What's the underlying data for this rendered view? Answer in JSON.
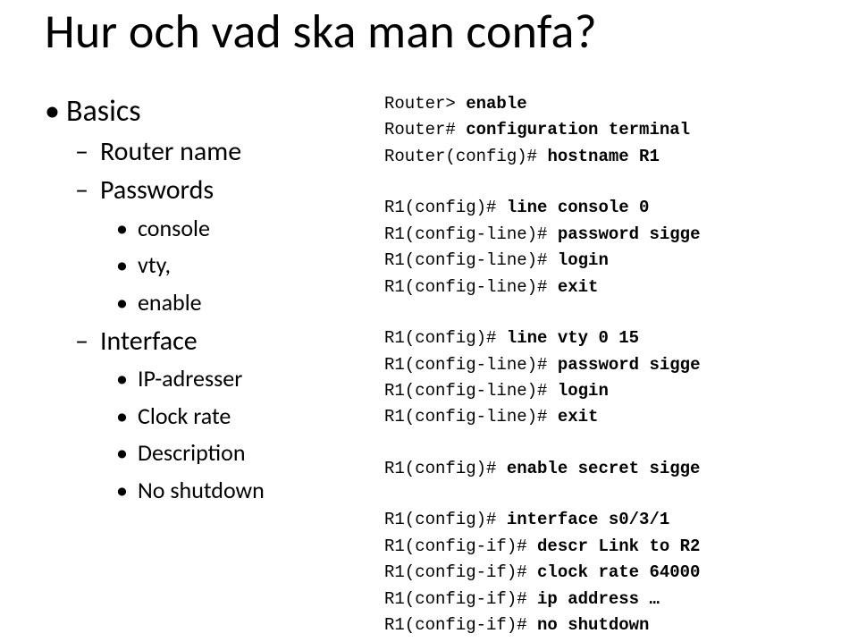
{
  "title": "Hur och vad ska man confa?",
  "bullets": {
    "l1a": "Basics",
    "l2a": "Router name",
    "l2b": "Passwords",
    "l3a": "console",
    "l3b": "vty,",
    "l3c": "enable",
    "l2c": "Interface",
    "l3d": "IP-adresser",
    "l3e": "Clock rate",
    "l3f": "Description",
    "l3g": "No shutdown"
  },
  "term": {
    "b1": {
      "p1": "Router> ",
      "c1": "enable",
      "p2": "Router# ",
      "c2": "configuration terminal",
      "p3": "Router(config)# ",
      "c3": "hostname R1"
    },
    "b2": {
      "p1": "R1(config)# ",
      "c1": "line console 0",
      "p2": "R1(config-line)# ",
      "c2": "password sigge",
      "p3": "R1(config-line)# ",
      "c3": "login",
      "p4": "R1(config-line)# ",
      "c4": "exit"
    },
    "b3": {
      "p1": "R1(config)# ",
      "c1": "line vty 0 15",
      "p2": "R1(config-line)# ",
      "c2": "password sigge",
      "p3": "R1(config-line)# ",
      "c3": "login",
      "p4": "R1(config-line)# ",
      "c4": "exit"
    },
    "b4": {
      "p1": "R1(config)# ",
      "c1": "enable secret sigge"
    },
    "b5": {
      "p1": "R1(config)# ",
      "c1": "interface s0/3/1",
      "p2": "R1(config-if)# ",
      "c2": "descr Link to R2",
      "p3": "R1(config-if)# ",
      "c3": "clock rate 64000",
      "p4": "R1(config-if)# ",
      "c4": "ip address …",
      "p5": "R1(config-if)# ",
      "c5": "no shutdown"
    }
  }
}
